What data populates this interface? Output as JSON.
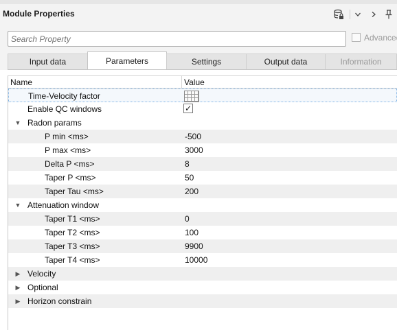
{
  "panel": {
    "title": "Module Properties",
    "toolbar_icons": [
      "database-lock-icon",
      "chevron-down-icon",
      "chevron-right-icon",
      "pin-icon"
    ]
  },
  "search": {
    "placeholder": "Search Property",
    "advanced_label": "Advanced",
    "advanced_checked": false
  },
  "tabs": [
    {
      "label": "Input data",
      "active": false,
      "enabled": true
    },
    {
      "label": "Parameters",
      "active": true,
      "enabled": true
    },
    {
      "label": "Settings",
      "active": false,
      "enabled": true
    },
    {
      "label": "Output data",
      "active": false,
      "enabled": true
    },
    {
      "label": "Information",
      "active": false,
      "enabled": false
    }
  ],
  "grid": {
    "columns": [
      "Name",
      "Value"
    ],
    "rows": [
      {
        "name": "Time-Velocity factor",
        "value": "",
        "value_type": "table-editor-icon",
        "level": 1
      },
      {
        "name": "Enable QC windows",
        "value": "✓",
        "value_type": "checkbox",
        "checked": true,
        "level": 1
      },
      {
        "name": "Radon params",
        "value": "",
        "group": true,
        "expanded": true,
        "level": 0
      },
      {
        "name": "P min <ms>",
        "value": "-500",
        "level": 2
      },
      {
        "name": "P max <ms>",
        "value": "3000",
        "level": 2
      },
      {
        "name": "Delta P <ms>",
        "value": "8",
        "level": 2
      },
      {
        "name": "Taper P <ms>",
        "value": "50",
        "level": 2
      },
      {
        "name": "Taper Tau <ms>",
        "value": "200",
        "level": 2
      },
      {
        "name": "Attenuation window",
        "value": "",
        "group": true,
        "expanded": true,
        "level": 0
      },
      {
        "name": "Taper T1 <ms>",
        "value": "0",
        "level": 2
      },
      {
        "name": "Taper T2 <ms>",
        "value": "100",
        "level": 2
      },
      {
        "name": "Taper T3 <ms>",
        "value": "9900",
        "level": 2
      },
      {
        "name": "Taper T4 <ms>",
        "value": "10000",
        "level": 2
      },
      {
        "name": "Velocity",
        "value": "",
        "group": true,
        "expanded": false,
        "level": 0
      },
      {
        "name": "Optional",
        "value": "",
        "group": true,
        "expanded": false,
        "level": 0
      },
      {
        "name": "Horizon constrain",
        "value": "",
        "group": true,
        "expanded": false,
        "level": 0
      }
    ]
  }
}
